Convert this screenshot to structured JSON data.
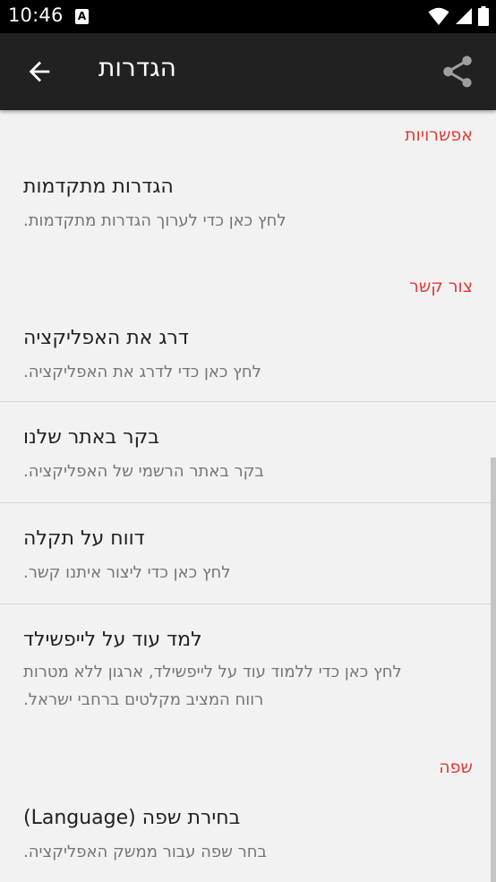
{
  "status": {
    "time": "10:46",
    "app_icon_letter": "A"
  },
  "toolbar": {
    "title": "הגדרות",
    "back_icon": "arrow-back-icon",
    "share_icon": "share-icon"
  },
  "sections": {
    "options": {
      "header": "אפשרויות"
    },
    "contact": {
      "header": "צור קשר"
    },
    "language": {
      "header": "שפה"
    }
  },
  "prefs": {
    "advanced": {
      "title": "הגדרות מתקדמות",
      "summary": "לחץ כאן כדי לערוך הגדרות מתקדמות."
    },
    "rate": {
      "title": "דרג את האפליקציה",
      "summary": "לחץ כאן כדי לדרג את האפליקציה."
    },
    "website": {
      "title": "בקר באתר שלנו",
      "summary": "בקר באתר הרשמי של האפליקציה."
    },
    "bug": {
      "title": "דווח על תקלה",
      "summary": "לחץ כאן כדי ליצור איתנו קשר."
    },
    "learn": {
      "title": "למד עוד על לייפשילד",
      "summary_line1": "לחץ כאן כדי ללמוד עוד על לייפשילד, ארגון ללא מטרות",
      "summary_line2": "רווח המציב מקלטים ברחבי ישראל."
    },
    "lang": {
      "title": "בחירת שפה (Language)",
      "summary": "בחר שפה עבור ממשק האפליקציה."
    }
  }
}
